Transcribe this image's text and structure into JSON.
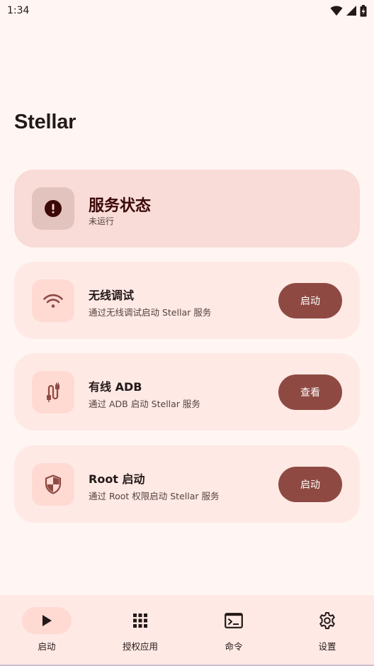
{
  "status_bar": {
    "time": "1:34"
  },
  "app": {
    "title": "Stellar"
  },
  "status_card": {
    "title": "服务状态",
    "subtitle": "未运行",
    "icon": "alert-icon"
  },
  "options": [
    {
      "title": "无线调试",
      "subtitle": "通过无线调试启动 Stellar 服务",
      "button": "启动",
      "icon": "wifi-icon"
    },
    {
      "title": "有线 ADB",
      "subtitle": "通过 ADB 启动 Stellar 服务",
      "button": "查看",
      "icon": "usb-cable-icon"
    },
    {
      "title": "Root 启动",
      "subtitle": "通过 Root 权限启动 Stellar 服务",
      "button": "启动",
      "icon": "shield-icon"
    }
  ],
  "nav": [
    {
      "label": "启动",
      "icon": "play-icon",
      "active": true
    },
    {
      "label": "授权应用",
      "icon": "grid-icon",
      "active": false
    },
    {
      "label": "命令",
      "icon": "terminal-icon",
      "active": false
    },
    {
      "label": "设置",
      "icon": "gear-icon",
      "active": false
    }
  ],
  "colors": {
    "background": "#FFF6F3",
    "card": "#FFE9E5",
    "status_card": "#F9DCD7",
    "primary": "#8E4A42",
    "icon_box": "#FFDAD3"
  }
}
